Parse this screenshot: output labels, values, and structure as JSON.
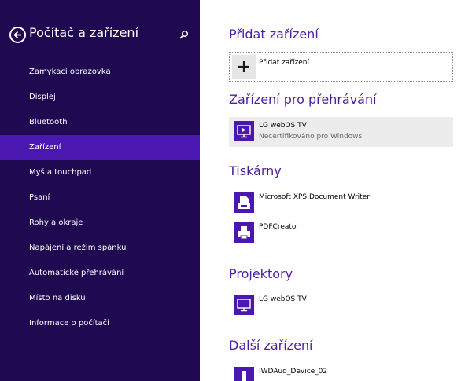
{
  "sidebar": {
    "title": "Počítač a zařízení",
    "items": [
      {
        "label": "Zamykací obrazovka"
      },
      {
        "label": "Displej"
      },
      {
        "label": "Bluetooth"
      },
      {
        "label": "Zařízení"
      },
      {
        "label": "Myš a touchpad"
      },
      {
        "label": "Psaní"
      },
      {
        "label": "Rohy a okraje"
      },
      {
        "label": "Napájení a režim spánku"
      },
      {
        "label": "Automatické přehrávání"
      },
      {
        "label": "Místo na disku"
      },
      {
        "label": "Informace o počítači"
      }
    ],
    "active_index": 3,
    "icons": {
      "back": "back-arrow-icon",
      "search": "search-icon"
    }
  },
  "main": {
    "add_section": {
      "title": "Přidat zařízení",
      "button_label": "Přidat zařízení"
    },
    "playback_section": {
      "title": "Zařízení pro přehrávání",
      "devices": [
        {
          "name": "LG webOS TV",
          "status": "Necertifikováno pro Windows",
          "icon": "monitor-play-icon"
        }
      ]
    },
    "printers_section": {
      "title": "Tiskárny",
      "devices": [
        {
          "name": "Microsoft XPS Document Writer",
          "icon": "document-printer-icon"
        },
        {
          "name": "PDFCreator",
          "icon": "printer-icon"
        }
      ]
    },
    "projectors_section": {
      "title": "Projektory",
      "devices": [
        {
          "name": "LG webOS TV",
          "icon": "monitor-icon"
        }
      ]
    },
    "other_section": {
      "title": "Další zařízení",
      "devices": [
        {
          "name": "IWDAud_Device_02",
          "icon": "device-icon"
        }
      ]
    }
  },
  "colors": {
    "sidebar_bg": "#1f0a52",
    "sidebar_active": "#4a17b0",
    "accent": "#4d1ea0",
    "icon_tile": "#4a17b0",
    "selected_row": "#ececec"
  }
}
